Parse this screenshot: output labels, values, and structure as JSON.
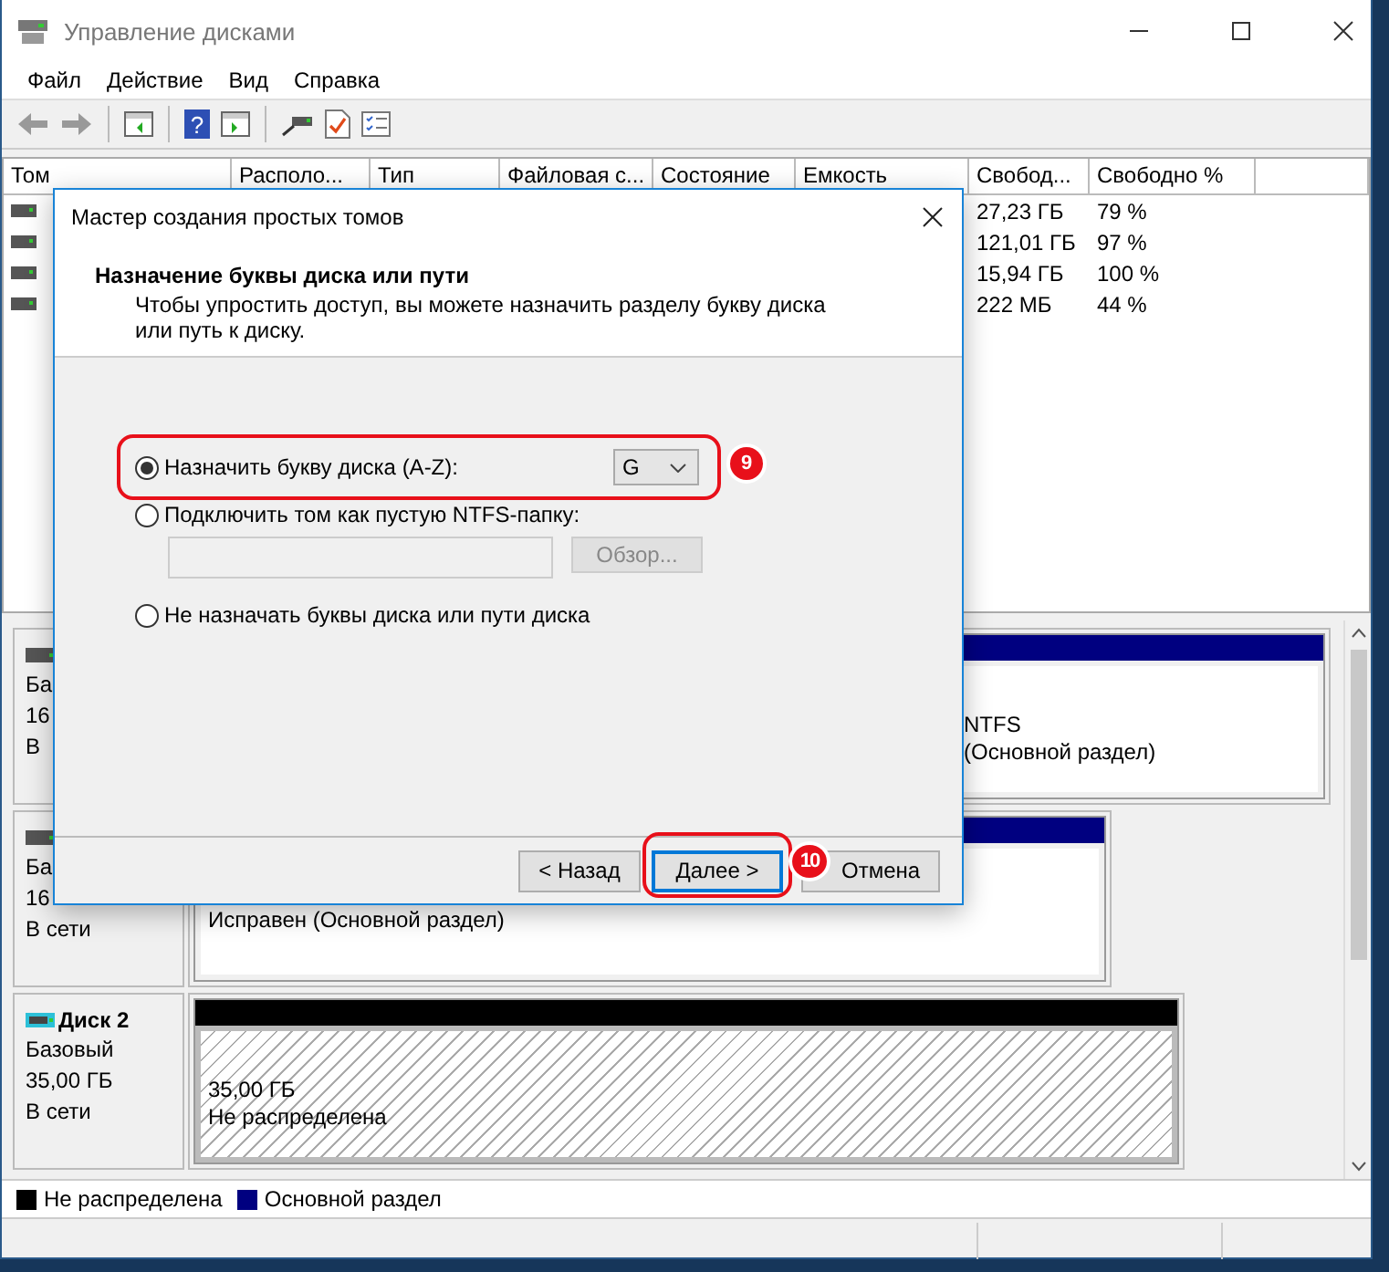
{
  "window": {
    "title": "Управление дисками"
  },
  "menu": [
    "Файл",
    "Действие",
    "Вид",
    "Справка"
  ],
  "volume_list": {
    "columns": [
      "Том",
      "Располо...",
      "Тип",
      "Файловая с...",
      "Состояние",
      "Емкость",
      "Свобод...",
      "Свободно %"
    ],
    "rows": [
      {
        "free": "27,23 ГБ",
        "free_pct": "79 %"
      },
      {
        "free": "121,01 ГБ",
        "free_pct": "97 %"
      },
      {
        "free": "15,94 ГБ",
        "free_pct": "100 %"
      },
      {
        "free": "222 МБ",
        "free_pct": "44 %"
      }
    ]
  },
  "toolbar": {
    "help_glyph": "?"
  },
  "disks": [
    {
      "label": [
        "Ба",
        "16",
        "В"
      ],
      "partitions": [
        {
          "kind": "primary",
          "lines": [
            "NTFS",
            "(Основной раздел)"
          ]
        }
      ]
    },
    {
      "label": [
        "Ба",
        "16",
        "В сети"
      ],
      "partitions": [
        {
          "kind": "primary",
          "lines": [
            "Исправен (Основной раздел)"
          ]
        }
      ]
    },
    {
      "name": "Диск 2",
      "label": [
        "Базовый",
        "35,00 ГБ",
        "В сети"
      ],
      "partitions": [
        {
          "kind": "unallocated",
          "lines": [
            "35,00 ГБ",
            "Не распределена"
          ]
        }
      ]
    }
  ],
  "legend": [
    {
      "label": "Не распределена",
      "color": "#000000"
    },
    {
      "label": "Основной раздел",
      "color": "#000080"
    }
  ],
  "dialog": {
    "title": "Мастер создания простых томов",
    "heading": "Назначение буквы диска или пути",
    "description": "Чтобы упростить доступ, вы можете назначить разделу букву диска или путь к диску.",
    "options": [
      {
        "kind": "letter",
        "label": "Назначить букву диска (A-Z):",
        "selected": true,
        "value": "G"
      },
      {
        "kind": "folder",
        "label": "Подключить том как пустую NTFS-папку:",
        "selected": false,
        "button": "Обзор..."
      },
      {
        "kind": "none",
        "label": "Не назначать буквы диска или пути диска",
        "selected": false
      }
    ],
    "buttons": [
      "< Назад",
      "Далее >",
      "Отмена"
    ]
  },
  "annotations": [
    "9",
    "10"
  ]
}
